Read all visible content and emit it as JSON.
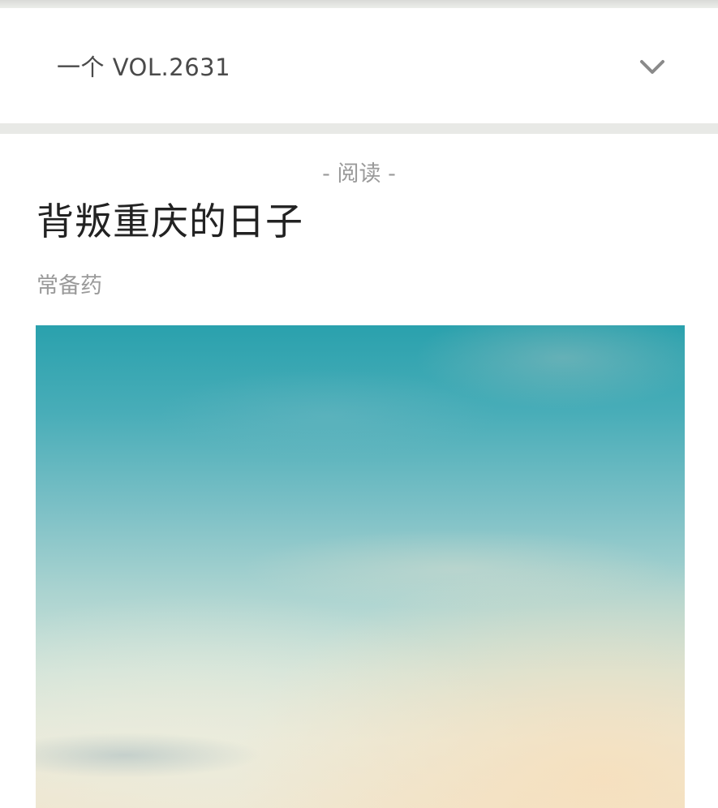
{
  "header": {
    "volume_title": "一个 VOL.2631",
    "toggle_icon": "chevron-down-icon"
  },
  "article": {
    "category": "- 阅读 -",
    "title": "背叛重庆的日子",
    "author": "常备药"
  },
  "colors": {
    "separator": "#e8e9e6",
    "title_text": "#222222",
    "muted_text": "#9a9a9a",
    "sky_top": "#2aa1ad",
    "sky_bottom": "#f1e4cc"
  }
}
